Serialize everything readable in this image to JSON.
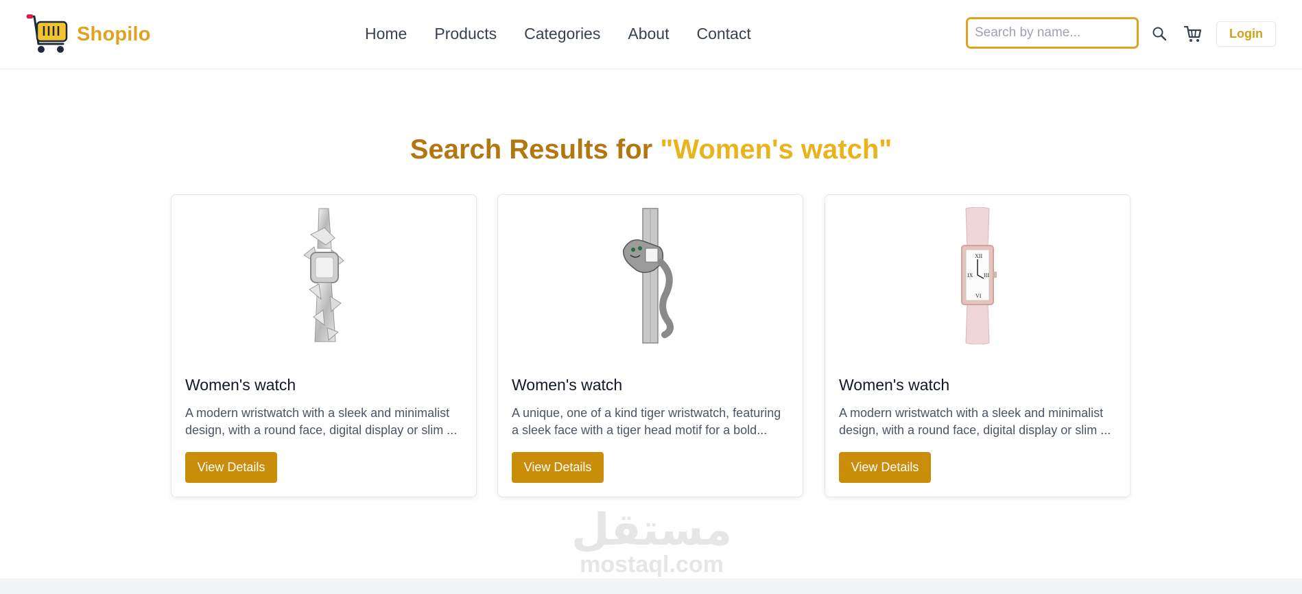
{
  "brand": {
    "name": "Shopilo",
    "accent": "#e0a321",
    "logo_icon": "shopping-cart-icon"
  },
  "nav": {
    "items": [
      "Home",
      "Products",
      "Categories",
      "About",
      "Contact"
    ]
  },
  "search": {
    "placeholder": "Search by name...",
    "value": "",
    "icon": "search-icon"
  },
  "cart": {
    "icon": "cart-icon"
  },
  "login": {
    "label": "Login"
  },
  "results": {
    "prefix": "Search Results for ",
    "query": "\"Women's watch\""
  },
  "products": [
    {
      "name": "Women's watch",
      "description": "A modern wristwatch with a sleek and minimalist design, with a round face, digital display or slim ...",
      "button": "View Details",
      "image": "diamond-watch-image"
    },
    {
      "name": "Women's watch",
      "description": "A unique, one of a kind tiger wristwatch, featuring a sleek face with a tiger head motif for a bold...",
      "button": "View Details",
      "image": "panther-watch-image"
    },
    {
      "name": "Women's watch",
      "description": "A modern wristwatch with a sleek and minimalist design, with a round face, digital display or slim ...",
      "button": "View Details",
      "image": "pink-strap-watch-image"
    }
  ],
  "watermark": {
    "arabic": "مستقل",
    "latin": "mostaql.com"
  },
  "colors": {
    "title": "#b27710",
    "query": "#e9b31c",
    "button": "#c98d0a"
  }
}
